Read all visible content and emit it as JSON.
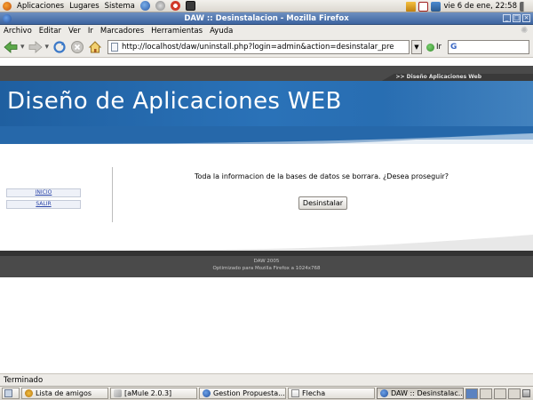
{
  "top_panel": {
    "menus": [
      "Aplicaciones",
      "Lugares",
      "Sistema"
    ],
    "clock": "vie  6 de ene, 22:58"
  },
  "window": {
    "title": "DAW :: Desinstalacion - Mozilla Firefox"
  },
  "menubar": {
    "items": [
      "Archivo",
      "Editar",
      "Ver",
      "Ir",
      "Marcadores",
      "Herramientas",
      "Ayuda"
    ]
  },
  "navbar": {
    "url": "http://localhost/daw/uninstall.php?login=admin&action=desinstalar_pre",
    "go_label": "Ir",
    "search_logo": "G"
  },
  "page": {
    "tab_text": ">> Diseño Aplicaciones Web",
    "banner_title": "Diseño de Aplicaciones WEB",
    "sidebar": {
      "inicio": "INICIO",
      "salir": "SALIR"
    },
    "message": "Toda la informacion de la bases de datos se borrara. ¿Desea proseguir?",
    "button_label": "Desinstalar",
    "footer_line1": "DAW 2005",
    "footer_line2": "Optimizado para Mozilla Firefox a 1024x768"
  },
  "status": {
    "text": "Terminado"
  },
  "taskbar": {
    "buttons": [
      "Lista de amigos",
      "[aMule 2.0.3]",
      "Gestion Propuesta...",
      "Flecha",
      "DAW :: Desinstalac..."
    ]
  },
  "colors": {
    "banner_blue": "#2a6db3",
    "footer_gray": "#4a4a4a",
    "title_bar": "#4a6fa8"
  }
}
